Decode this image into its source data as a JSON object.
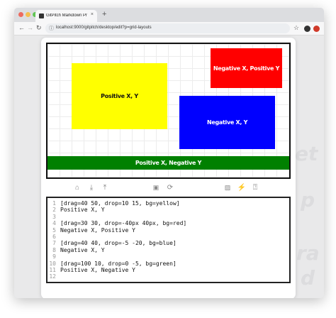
{
  "browser": {
    "tab_title": "GitPitch Markdown Presentati",
    "tab_close": "×",
    "new_tab": "+",
    "url": "localhost:9000/gitpitch/desktop/edit?p=grid-layouts",
    "traffic_lights": [
      "#ed6a5e",
      "#f5bf4f",
      "#61c554"
    ]
  },
  "slide": {
    "boxes": [
      {
        "label": "Positive X, Y",
        "bg": "#ffff00",
        "fg": "#111111"
      },
      {
        "label": "Negative X, Positive Y",
        "bg": "#ff0000",
        "fg": "#ffffff"
      },
      {
        "label": "Negative X, Y",
        "bg": "#0000ff",
        "fg": "#ffffff"
      },
      {
        "label": "Positive X, Negative Y",
        "bg": "#008000",
        "fg": "#ffffff"
      }
    ]
  },
  "toolbar_icons": [
    "home-icon",
    "download-icon",
    "upload-icon",
    "save-icon",
    "refresh-icon",
    "image-icon",
    "bolt-icon",
    "help-icon"
  ],
  "editor": {
    "lines": [
      {
        "n": "1",
        "text": "[drag=40 50, drop=10 15, bg=yellow]"
      },
      {
        "n": "2",
        "text": "Positive X, Y"
      },
      {
        "n": "3",
        "text": ""
      },
      {
        "n": "4",
        "text": "[drag=30 30, drop=-40px 40px, bg=red]"
      },
      {
        "n": "5",
        "text": "Negative X, Positive Y"
      },
      {
        "n": "6",
        "text": ""
      },
      {
        "n": "7",
        "text": "[drag=40 40, drop=-5 -20, bg=blue]"
      },
      {
        "n": "8",
        "text": "Negative X, Y"
      },
      {
        "n": "9",
        "text": ""
      },
      {
        "n": "10",
        "text": "[drag=100 10, drop=0 -5, bg=green]"
      },
      {
        "n": "11",
        "text": "Positive X, Negative Y"
      },
      {
        "n": "12",
        "text": ""
      }
    ]
  }
}
